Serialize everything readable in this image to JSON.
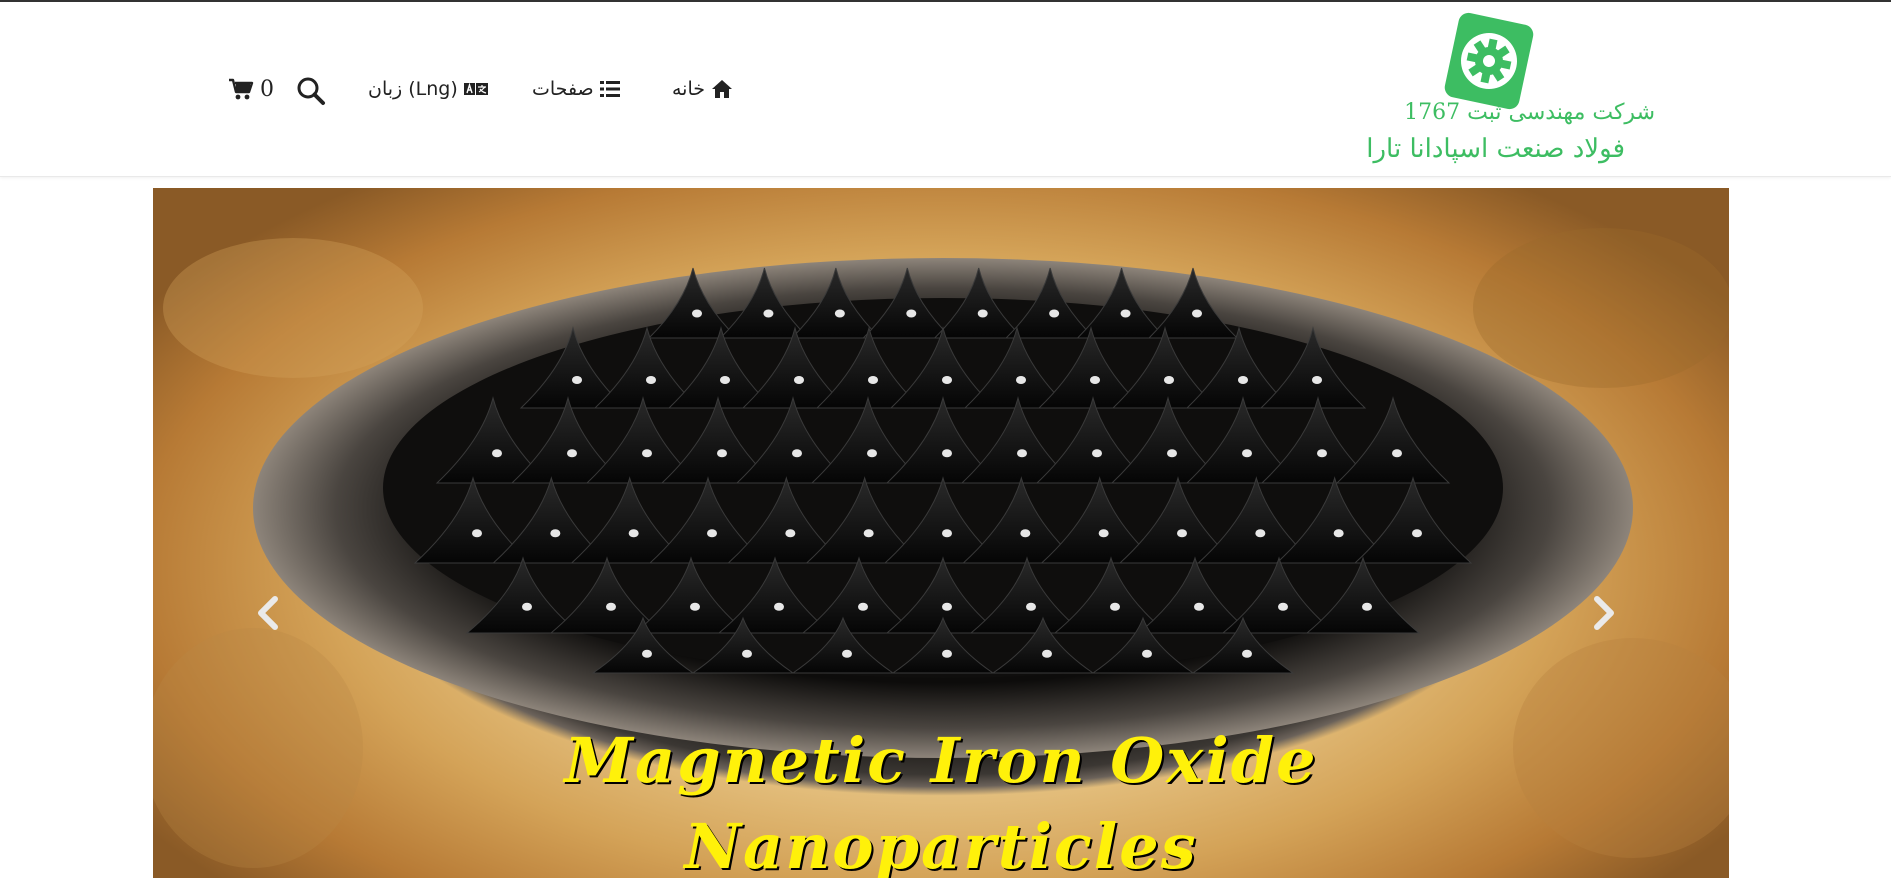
{
  "logo": {
    "line1": "شرکت مهندسی        ثبت 1767",
    "line2": "فولاد صنعت اسپادانا تارا",
    "brand_color": "#3dbd62"
  },
  "nav": {
    "home_label": "خانه",
    "home_icon": "home-icon",
    "pages_label": "صفحات",
    "pages_icon": "list-icon",
    "language_label": "زبان (Lng)",
    "language_icon": "translate-icon",
    "search_icon": "search-icon",
    "cart_count": "0",
    "cart_icon": "cart-icon"
  },
  "slider": {
    "slide_title_line1": "Magnetic Iron Oxide",
    "slide_title_line2": "Nanoparticles",
    "prev_icon": "chevron-left-icon",
    "next_icon": "chevron-right-icon",
    "title_color": "#fff10a"
  }
}
